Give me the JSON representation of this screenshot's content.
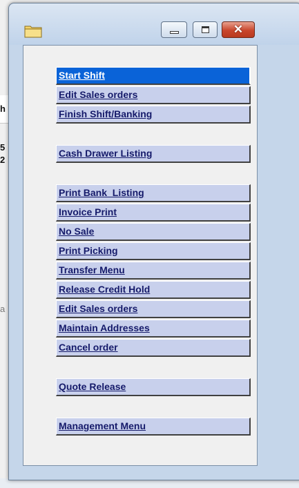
{
  "background_fragments": [
    "h",
    "5",
    "2",
    "a"
  ],
  "window": {
    "controls": {
      "minimize_icon": "minimize-icon",
      "maximize_icon": "maximize-icon",
      "close_icon": "close-icon",
      "close_glyph": "✕"
    },
    "title_icon": "folder-icon"
  },
  "menu": [
    {
      "label": "Start Shift",
      "selected": true
    },
    {
      "label": "Edit Sales orders",
      "selected": false
    },
    {
      "label": "Finish Shift/Banking",
      "selected": false
    },
    {
      "label": "Cash Drawer Listing",
      "selected": false
    },
    {
      "label": "Print Bank  Listing",
      "selected": false
    },
    {
      "label": "Invoice Print",
      "selected": false
    },
    {
      "label": "No Sale",
      "selected": false
    },
    {
      "label": "Print Picking",
      "selected": false
    },
    {
      "label": "Transfer Menu",
      "selected": false
    },
    {
      "label": "Release Credit Hold",
      "selected": false
    },
    {
      "label": "Edit Sales orders",
      "selected": false
    },
    {
      "label": "Maintain Addresses",
      "selected": false
    },
    {
      "label": "Cancel order",
      "selected": false
    },
    {
      "label": "Quote Release",
      "selected": false
    },
    {
      "label": "Management Menu",
      "selected": false
    }
  ],
  "colors": {
    "selected_bg": "#0a63d8",
    "button_bg": "#c8d0ec",
    "button_text": "#151a6a"
  }
}
